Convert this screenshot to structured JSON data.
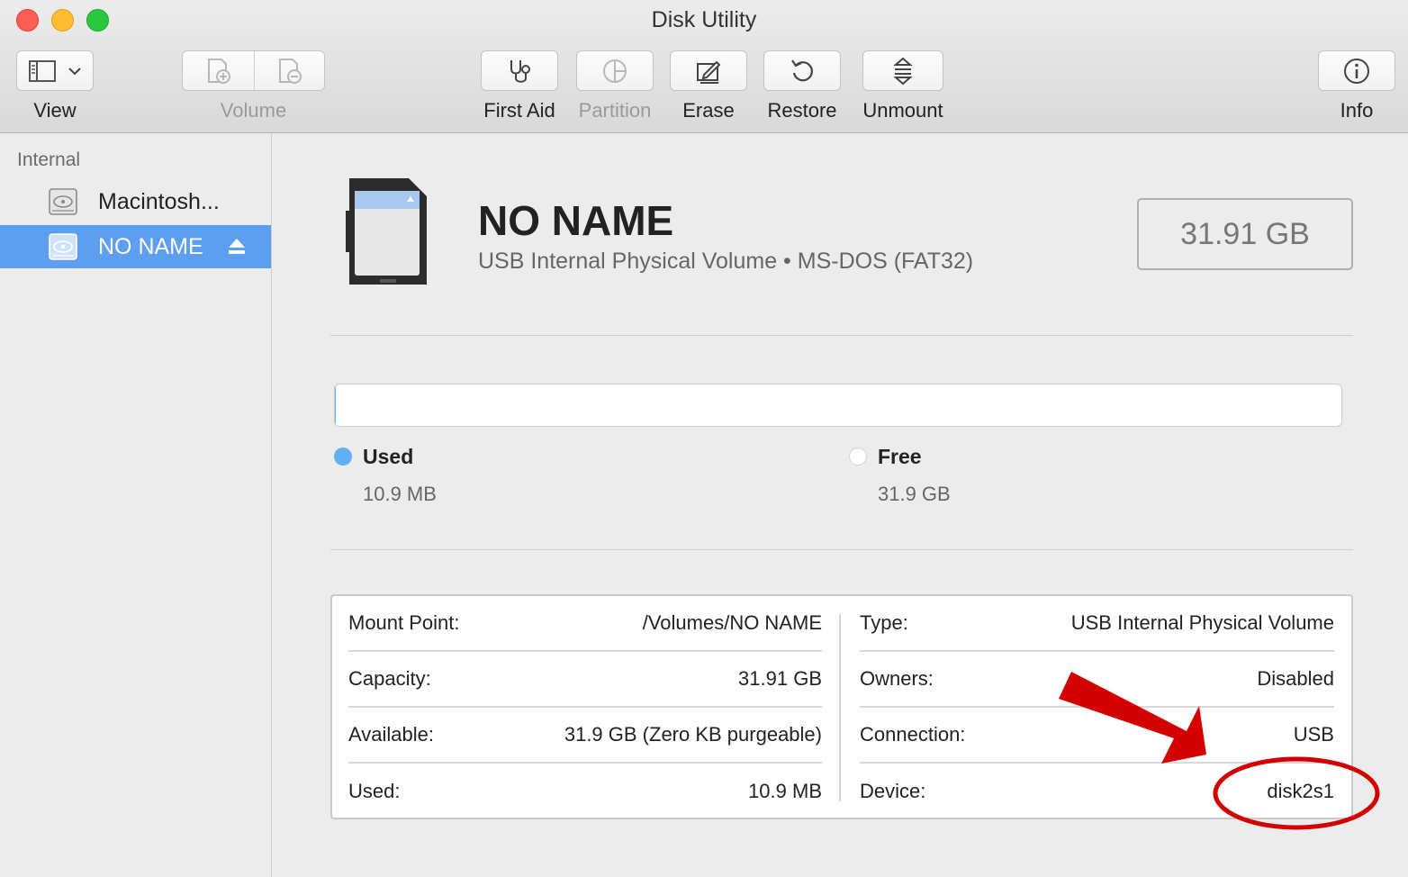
{
  "window": {
    "title": "Disk Utility"
  },
  "toolbar": {
    "view_label": "View",
    "volume_label": "Volume",
    "first_aid_label": "First Aid",
    "partition_label": "Partition",
    "erase_label": "Erase",
    "restore_label": "Restore",
    "unmount_label": "Unmount",
    "info_label": "Info"
  },
  "sidebar": {
    "section_header": "Internal",
    "items": [
      {
        "label": "Macintosh...",
        "icon": "hard-disk-icon",
        "selected": false
      },
      {
        "label": "NO NAME",
        "icon": "hard-disk-icon",
        "selected": true,
        "eject": true
      }
    ]
  },
  "volume": {
    "name": "NO NAME",
    "subtitle": "USB Internal Physical Volume • MS-DOS (FAT32)",
    "capacity_badge": "31.91 GB",
    "icon": "sd-card-icon"
  },
  "usage": {
    "used_fraction": 0.0003,
    "used_title": "Used",
    "used_value": "10.9 MB",
    "free_title": "Free",
    "free_value": "31.9 GB",
    "used_color": "#5fb0f6",
    "free_color": "#ffffff"
  },
  "info": {
    "left": [
      {
        "key": "Mount Point:",
        "value": "/Volumes/NO NAME"
      },
      {
        "key": "Capacity:",
        "value": "31.91 GB"
      },
      {
        "key": "Available:",
        "value": "31.9 GB (Zero KB purgeable)"
      },
      {
        "key": "Used:",
        "value": "10.9 MB"
      }
    ],
    "right": [
      {
        "key": "Type:",
        "value": "USB Internal Physical Volume"
      },
      {
        "key": "Owners:",
        "value": "Disabled"
      },
      {
        "key": "Connection:",
        "value": "USB"
      },
      {
        "key": "Device:",
        "value": "disk2s1"
      }
    ]
  },
  "annotation": {
    "color": "#d40000",
    "highlight": "info.right.3.value"
  }
}
